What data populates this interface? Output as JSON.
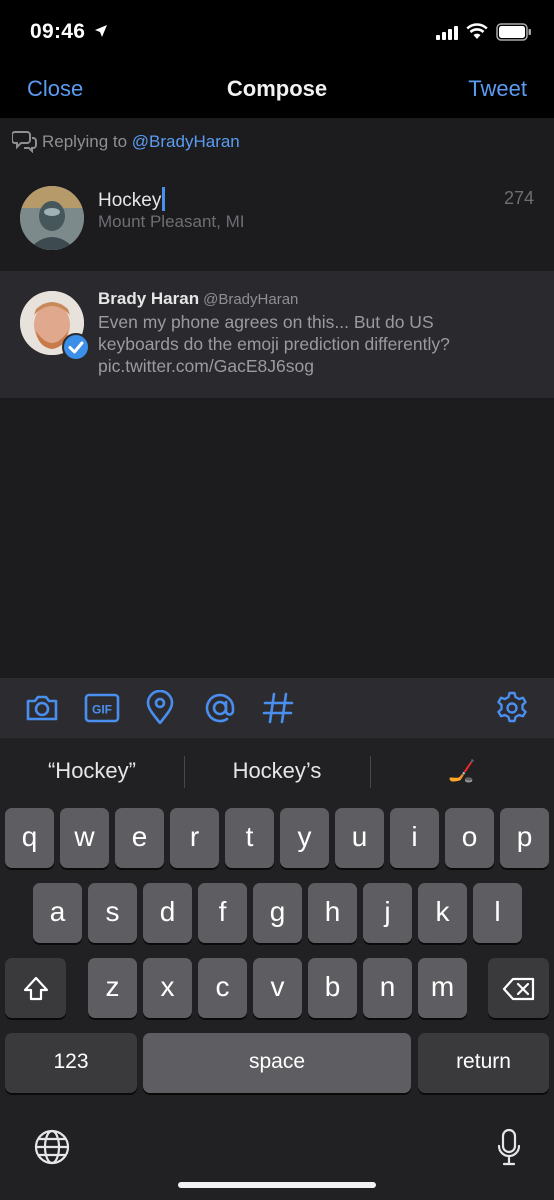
{
  "status": {
    "time": "09:46"
  },
  "nav": {
    "close": "Close",
    "title": "Compose",
    "tweet": "Tweet"
  },
  "reply": {
    "prefix": "Replying to",
    "handle": "@BradyHaran"
  },
  "compose": {
    "text": "Hockey",
    "location": "Mount Pleasant, MI",
    "char_count": "274"
  },
  "quoted": {
    "name": "Brady Haran",
    "handle": "@BradyHaran",
    "body": "Even my phone agrees on this... But do US keyboards do the emoji prediction differently? pic.twitter.com/GacE8J6sog"
  },
  "toolbar": {
    "icons": [
      "camera-icon",
      "gif-icon",
      "location-pin-icon",
      "mention-icon",
      "hashtag-icon",
      "settings-icon"
    ],
    "gif_label": "GIF"
  },
  "keyboard": {
    "suggestions": [
      "“Hockey”",
      "Hockey’s",
      "🏒"
    ],
    "row1": [
      "q",
      "w",
      "e",
      "r",
      "t",
      "y",
      "u",
      "i",
      "o",
      "p"
    ],
    "row2": [
      "a",
      "s",
      "d",
      "f",
      "g",
      "h",
      "j",
      "k",
      "l"
    ],
    "row3": [
      "z",
      "x",
      "c",
      "v",
      "b",
      "n",
      "m"
    ],
    "numbers_label": "123",
    "space_label": "space",
    "return_label": "return"
  },
  "colors": {
    "accent": "#5b9cf2",
    "background": "#1c1c1e",
    "verified": "#3b8fe8"
  }
}
